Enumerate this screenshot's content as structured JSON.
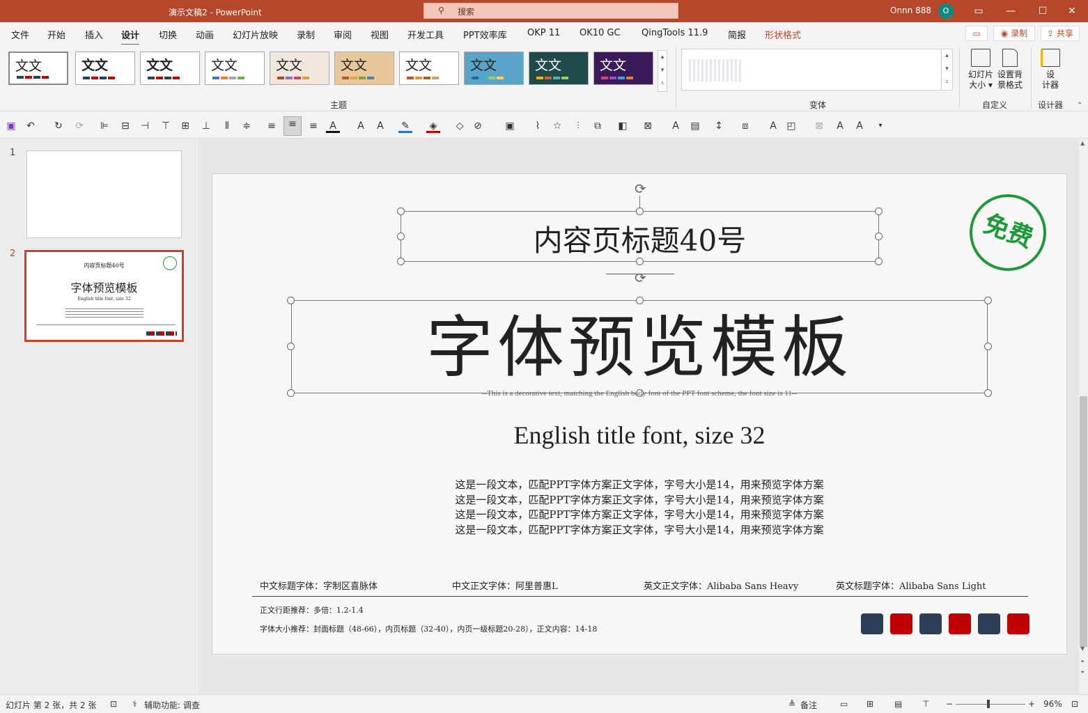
{
  "titlebar": {
    "doc_title": "演示文稿2  -  PowerPoint",
    "search_placeholder": "搜索",
    "user_name": "Onnn 888",
    "avatar_initial": "O"
  },
  "tabs": [
    {
      "label": "文件"
    },
    {
      "label": "开始"
    },
    {
      "label": "插入"
    },
    {
      "label": "设计"
    },
    {
      "label": "切换"
    },
    {
      "label": "动画"
    },
    {
      "label": "幻灯片放映"
    },
    {
      "label": "录制"
    },
    {
      "label": "审阅"
    },
    {
      "label": "视图"
    },
    {
      "label": "开发工具"
    },
    {
      "label": "PPT效率库"
    },
    {
      "label": "OKP 11"
    },
    {
      "label": "OK10 GC"
    },
    {
      "label": "QingTools 11.9"
    },
    {
      "label": "简报"
    },
    {
      "label": "形状格式"
    }
  ],
  "tab_right": {
    "record": "◉ 录制",
    "share": "⇪ 共享"
  },
  "ribbon": {
    "theme_glyph": "文文",
    "group_themes": "主题",
    "group_variants": "变体",
    "group_custom": "自定义",
    "group_designer": "设计器",
    "slide_size_label": "幻灯片\n大小 ▾",
    "bg_format_label": "设置背\n景格式",
    "designer_label": "设\n计器"
  },
  "slides_pane": {
    "n1": "1",
    "n2": "2"
  },
  "slide": {
    "title": "内容页标题40号",
    "main_title": "字体预览模板",
    "deco_text": "--This is a decorative text, matching the English body font of the PPT font scheme, the font size is 11--",
    "en_title": "English title font, size 32",
    "body_lines": [
      "这是一段文本，匹配PPT字体方案正文字体，字号大小是14，用来预览字体方案",
      "这是一段文本，匹配PPT字体方案正文字体，字号大小是14，用来预览字体方案",
      "这是一段文本，匹配PPT字体方案正文字体，字号大小是14，用来预览字体方案",
      "这是一段文本，匹配PPT字体方案正文字体，字号大小是14，用来预览字体方案"
    ],
    "font_info": [
      "中文标题字体：字制区喜脉体",
      "中文正文字体：阿里普惠L",
      "英文正文字体：Alibaba Sans Heavy",
      "英文标题字体：Alibaba Sans Light"
    ],
    "line_spacing": "正文行距推荐：多倍：1.2-1.4",
    "size_recommend": "字体大小推荐：封面标题（48-66），内页标题（32-40），内页一级标题20-28），正文内容：14-18",
    "stamp": "免费",
    "chip_colors": [
      "#2c3e57",
      "#c00000",
      "#2c3e57",
      "#c00000",
      "#2c3e57",
      "#c00000"
    ]
  },
  "status": {
    "slide_info": "幻灯片 第 2 张，共 2 张",
    "accessibility": "辅助功能: 调查",
    "notes": "备注",
    "zoom": "96%"
  }
}
